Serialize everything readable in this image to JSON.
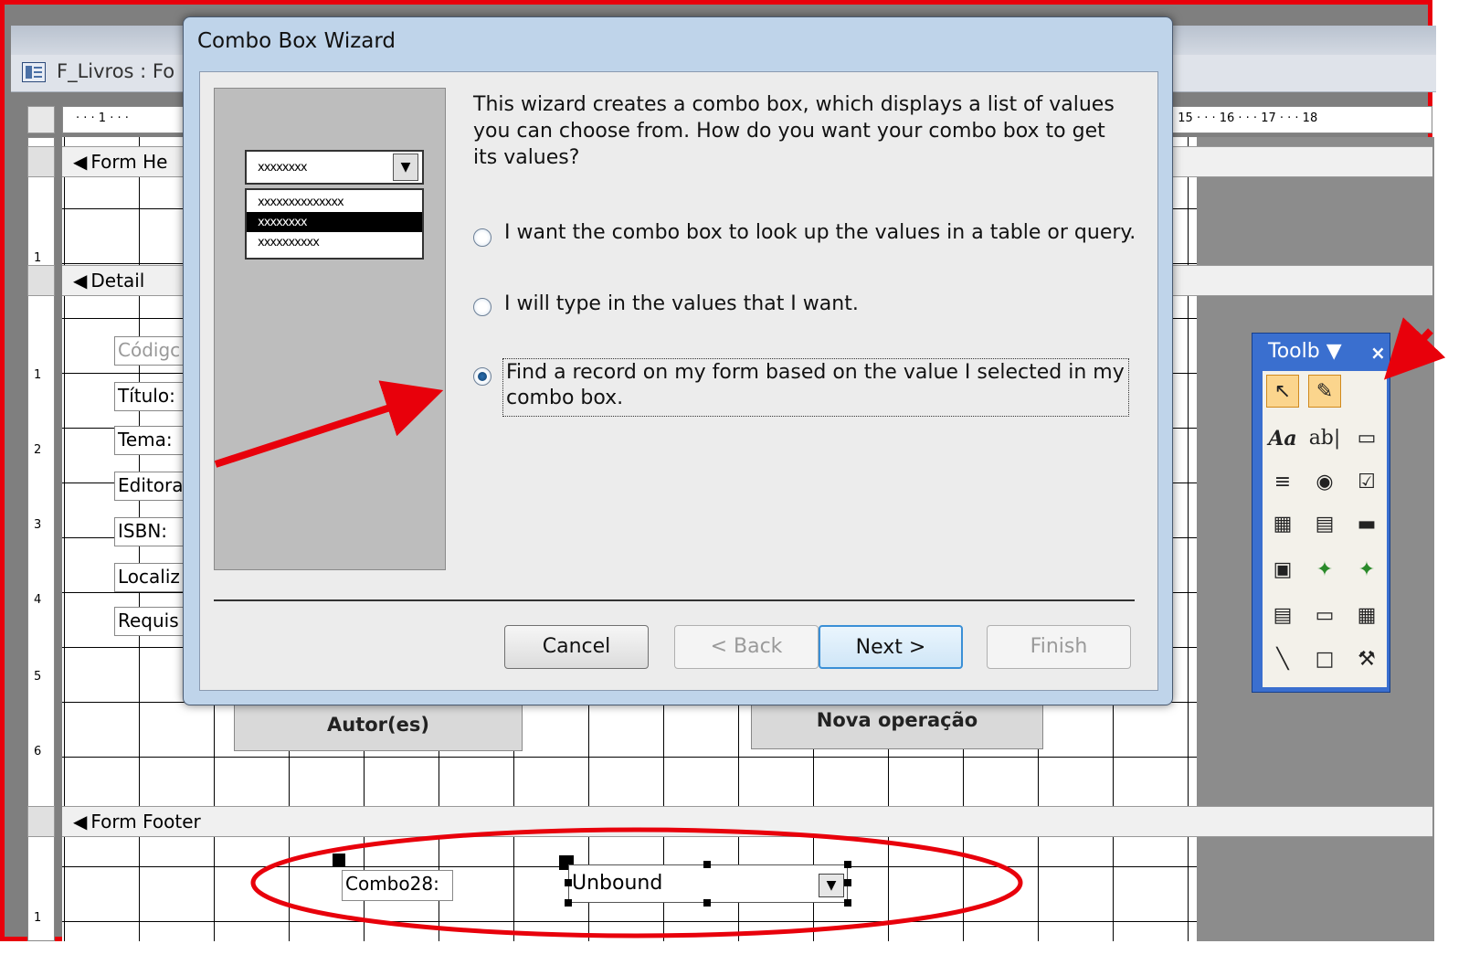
{
  "window": {
    "title": "F_Livros : Fo"
  },
  "ruler": {
    "h_left": "· · · 1 · · ·",
    "h_right": "· 15 · · · 16 · · · 17 · · · 18",
    "v_nums": [
      "1",
      "1",
      "2",
      "3",
      "4",
      "5",
      "6",
      "1"
    ]
  },
  "sections": {
    "header": "Form He",
    "detail": "Detail",
    "footer": "Form Footer"
  },
  "detail_labels": [
    "Códigc",
    "Título:",
    "Tema:",
    "Editora",
    "ISBN:",
    "Localiz",
    "Requis"
  ],
  "form_buttons": {
    "autores": "Autor(es)",
    "nova_operacao": "Nova operação"
  },
  "dialog": {
    "title": "Combo Box Wizard",
    "intro": "This wizard creates a combo box, which displays a list of values you can choose from.  How do you want your combo box to get its values?",
    "preview": {
      "combo_text": "xxxxxxxx",
      "items": [
        "xxxxxxxxxxxxxx",
        "xxxxxxxx",
        "xxxxxxxxxx"
      ],
      "selected_index": 1
    },
    "options": [
      {
        "label": "I want the combo box to look up the values in a table or query.",
        "checked": false
      },
      {
        "label": "I will type in the values that I want.",
        "checked": false
      },
      {
        "label": "Find a record on my form based on the value I selected in my combo box.",
        "checked": true
      }
    ],
    "buttons": {
      "cancel": "Cancel",
      "back": "< Back",
      "next": "Next >",
      "finish": "Finish"
    }
  },
  "toolbox": {
    "title": "Toolb ▼",
    "close": "×",
    "tools": [
      "↖",
      "✎",
      "Aa",
      "ab|",
      "▭",
      "≡",
      "◉",
      "☑",
      "▦",
      "▤",
      "▬",
      "▣",
      "✦",
      "✦",
      "▤",
      "▭",
      "▦",
      "╲",
      "□",
      "⚒"
    ]
  },
  "footer_controls": {
    "label": "Combo28:",
    "combo_value": "Unbound"
  },
  "colors": {
    "annotation": "#e8000b",
    "dialog_frame": "#bfd4ea",
    "toolbox": "#3a6fcf"
  }
}
